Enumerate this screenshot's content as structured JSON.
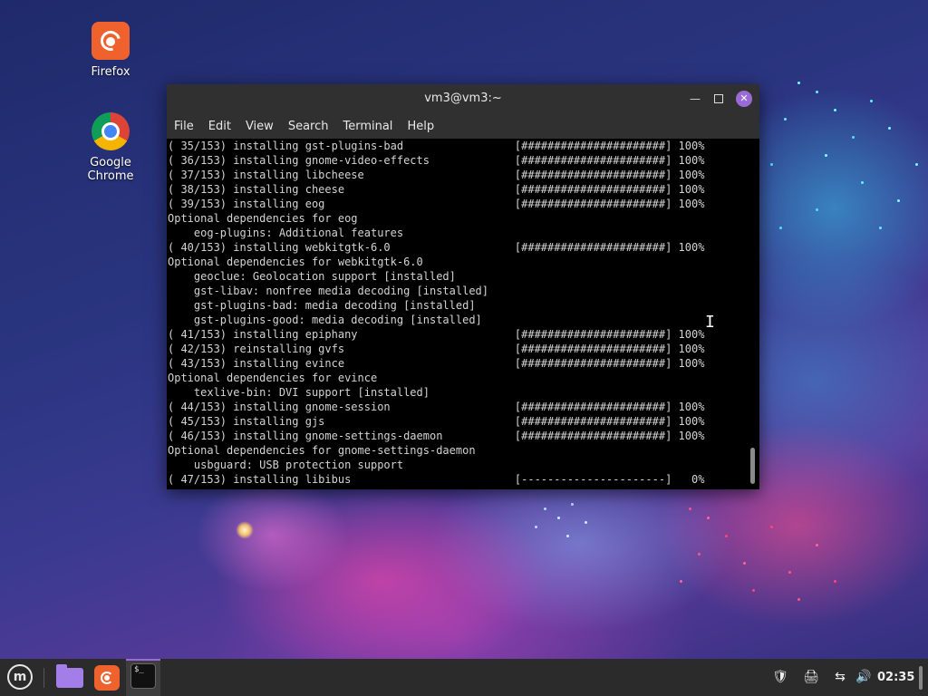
{
  "desktop": {
    "icons": [
      {
        "label": "Firefox"
      },
      {
        "label": "Google Chrome"
      }
    ]
  },
  "terminal": {
    "title": "vm3@vm3:~",
    "menu": [
      "File",
      "Edit",
      "View",
      "Search",
      "Terminal",
      "Help"
    ],
    "lines": [
      "( 35/153) installing gst-plugins-bad                 [######################] 100%",
      "( 36/153) installing gnome-video-effects             [######################] 100%",
      "( 37/153) installing libcheese                       [######################] 100%",
      "( 38/153) installing cheese                          [######################] 100%",
      "( 39/153) installing eog                             [######################] 100%",
      "Optional dependencies for eog",
      "    eog-plugins: Additional features",
      "( 40/153) installing webkitgtk-6.0                   [######################] 100%",
      "Optional dependencies for webkitgtk-6.0",
      "    geoclue: Geolocation support [installed]",
      "    gst-libav: nonfree media decoding [installed]",
      "    gst-plugins-bad: media decoding [installed]",
      "    gst-plugins-good: media decoding [installed]",
      "( 41/153) installing epiphany                        [######################] 100%",
      "( 42/153) reinstalling gvfs                          [######################] 100%",
      "( 43/153) installing evince                          [######################] 100%",
      "Optional dependencies for evince",
      "    texlive-bin: DVI support [installed]",
      "( 44/153) installing gnome-session                   [######################] 100%",
      "( 45/153) installing gjs                             [######################] 100%",
      "( 46/153) installing gnome-settings-daemon           [######################] 100%",
      "Optional dependencies for gnome-settings-daemon",
      "    usbguard: USB protection support",
      "( 47/153) installing libibus                         [----------------------]   0%"
    ]
  },
  "taskbar": {
    "clock": "02:35",
    "terminal_glyph": "$_"
  },
  "colors": {
    "accent": "#9a6bd6",
    "terminal_bg": "#000000",
    "terminal_text": "#d3d3d3",
    "titlebar": "#303030",
    "taskbar": "#2b2b2b"
  }
}
